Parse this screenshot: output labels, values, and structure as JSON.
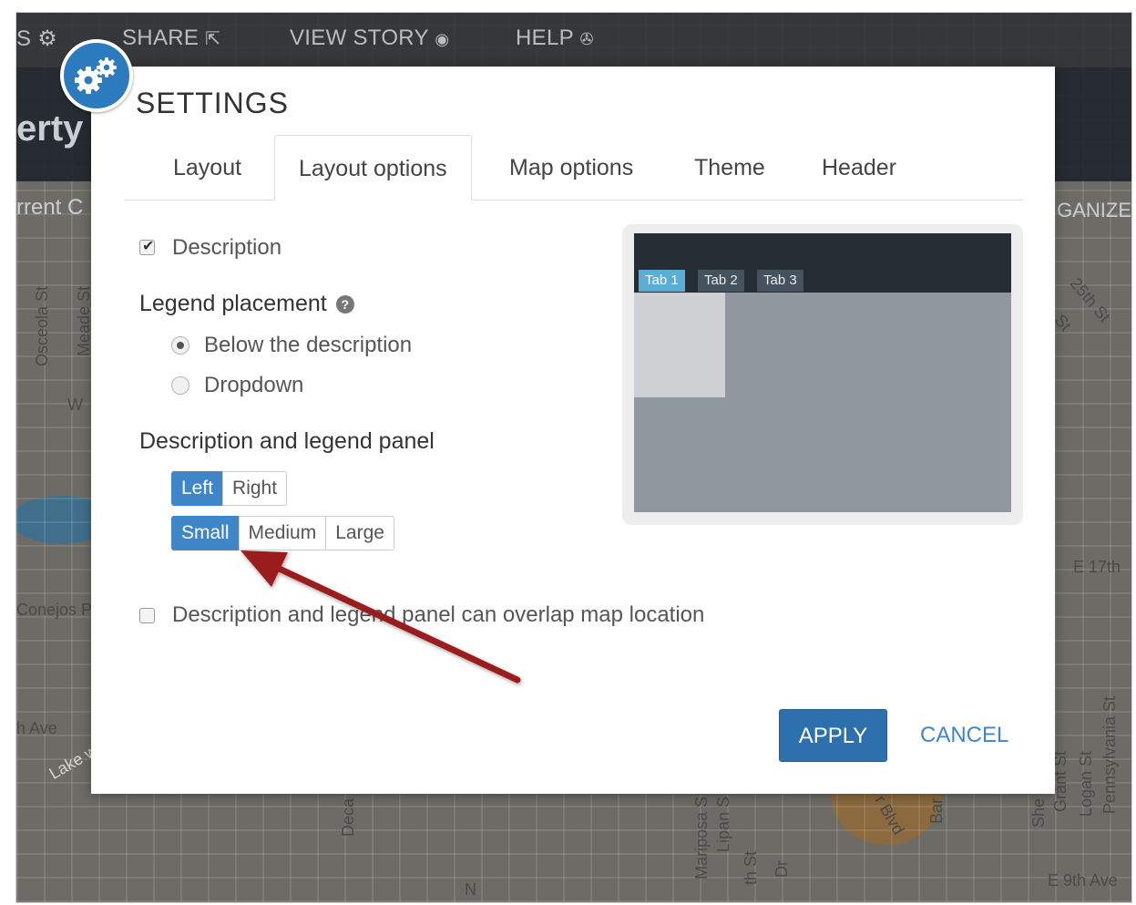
{
  "background": {
    "nav": {
      "share_label": "SHARE",
      "view_story_label": "VIEW STORY",
      "help_label": "HELP"
    },
    "title_fragment": "erty",
    "subtitle_fragment": "rrent C",
    "right_fragment": "GANIZE",
    "street_labels": [
      "Osceola St",
      "Meade St",
      "W",
      "Conejos P",
      "h Ave",
      "Lake w",
      "Deca",
      "N",
      "Mariposa S",
      "Lipan S",
      "th St",
      "Dr",
      "r Blvd",
      "Bar",
      "She",
      "Grant St",
      "Logan St",
      "Pennsylvania St",
      "E 17th",
      "E 9th Ave",
      "25th St",
      "St"
    ]
  },
  "modal": {
    "title": "SETTINGS",
    "tabs": [
      {
        "label": "Layout",
        "active": false
      },
      {
        "label": "Layout options",
        "active": true
      },
      {
        "label": "Map options",
        "active": false
      },
      {
        "label": "Theme",
        "active": false
      },
      {
        "label": "Header",
        "active": false
      }
    ],
    "description_checkbox": {
      "label": "Description",
      "checked": true
    },
    "legend_placement": {
      "heading": "Legend placement",
      "help_icon": "question-circle-icon",
      "options": [
        {
          "label": "Below the description",
          "selected": true
        },
        {
          "label": "Dropdown",
          "selected": false
        }
      ]
    },
    "panel": {
      "heading": "Description and legend panel",
      "position_options": [
        {
          "label": "Left",
          "active": true
        },
        {
          "label": "Right",
          "active": false
        }
      ],
      "size_options": [
        {
          "label": "Small",
          "active": true
        },
        {
          "label": "Medium",
          "active": false
        },
        {
          "label": "Large",
          "active": false
        }
      ]
    },
    "overlap_checkbox": {
      "label": "Description and legend panel can overlap map location",
      "checked": false
    },
    "preview": {
      "tabs": [
        "Tab 1",
        "Tab 2",
        "Tab 3"
      ],
      "active_tab": "Tab 1"
    },
    "apply_label": "APPLY",
    "cancel_label": "CANCEL"
  },
  "colors": {
    "primary": "#3f86c8",
    "apply": "#2e6fae",
    "arrow": "#9b1c1f",
    "preview_header": "#262d35"
  }
}
